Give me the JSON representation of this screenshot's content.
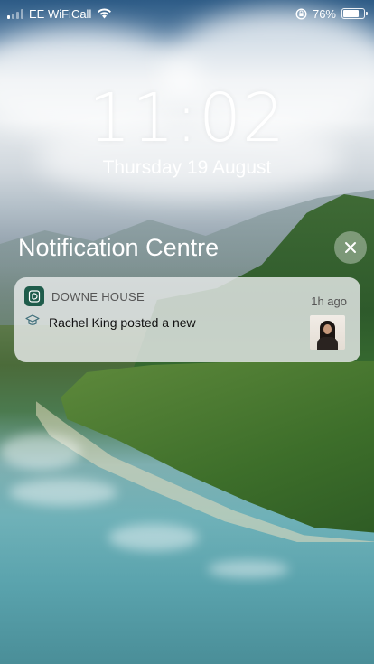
{
  "status_bar": {
    "carrier": "EE WiFiCall",
    "battery_percent_label": "76%",
    "battery_level": 0.76,
    "signal_bars_active": 1,
    "signal_bars_total": 4,
    "icons": [
      "signal-bars-icon",
      "wifi-icon",
      "orientation-lock-icon",
      "battery-icon"
    ]
  },
  "lock_screen": {
    "time": "11:02",
    "date": "Thursday 19 August"
  },
  "notification_centre": {
    "title": "Notification Centre",
    "clear_icon": "close-icon"
  },
  "notifications": [
    {
      "app_name": "DOWNE HOUSE",
      "time": "1h ago",
      "body": "Rachel King posted a new",
      "app_icon": "downe-house-app-icon",
      "type_icon": "graduation-cap-icon",
      "thumbnail": "user-avatar-thumbnail"
    }
  ],
  "colors": {
    "app_icon_bg": "#1f5c4b",
    "card_bg": "#e8eaea"
  }
}
